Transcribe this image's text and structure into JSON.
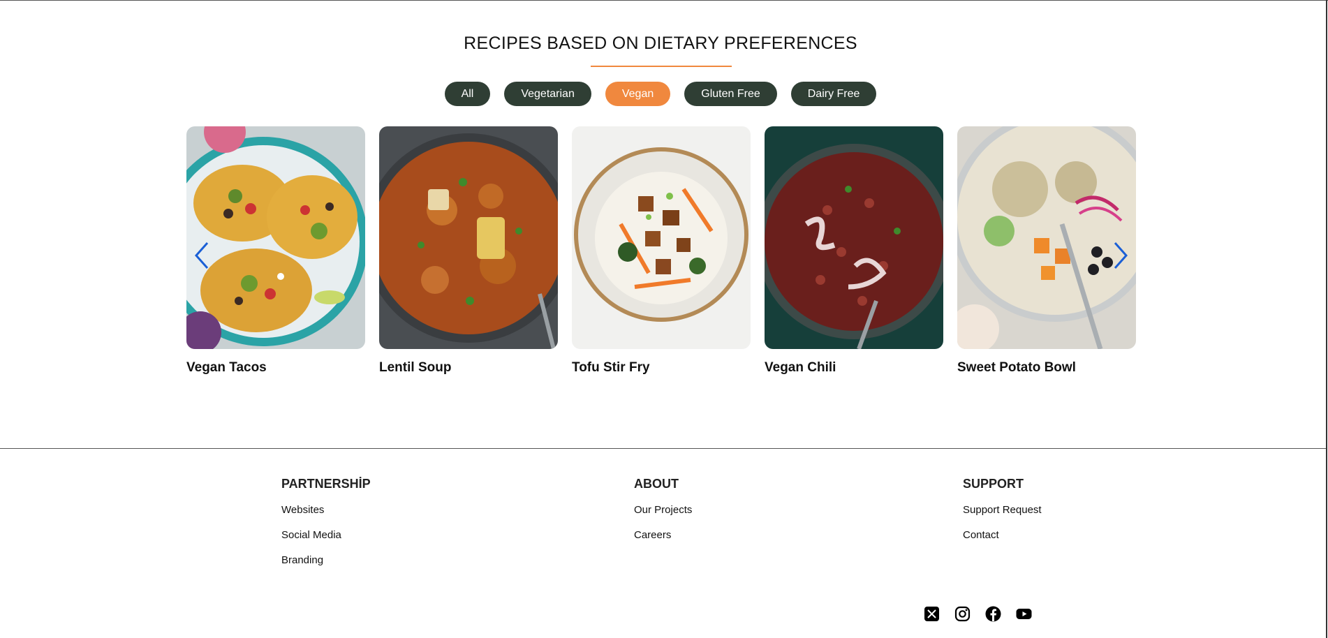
{
  "section": {
    "title": "RECIPES BASED ON DIETARY PREFERENCES"
  },
  "filters": [
    {
      "label": "All",
      "active": false
    },
    {
      "label": "Vegetarian",
      "active": false
    },
    {
      "label": "Vegan",
      "active": true
    },
    {
      "label": "Gluten Free",
      "active": false
    },
    {
      "label": "Dairy Free",
      "active": false
    }
  ],
  "recipes": [
    {
      "name": "Vegan Tacos"
    },
    {
      "name": "Lentil Soup"
    },
    {
      "name": "Tofu Stir Fry"
    },
    {
      "name": "Vegan Chili"
    },
    {
      "name": "Sweet Potato Bowl"
    }
  ],
  "footer": {
    "partnership": {
      "heading": "PARTNERSHİP",
      "links": [
        "Websites",
        "Social Media",
        "Branding"
      ]
    },
    "about": {
      "heading": "ABOUT",
      "links": [
        "Our Projects",
        "Careers"
      ]
    },
    "support": {
      "heading": "SUPPORT",
      "links": [
        "Support Request",
        "Contact"
      ]
    }
  },
  "socials": [
    {
      "icon": "x-twitter-icon"
    },
    {
      "icon": "instagram-icon"
    },
    {
      "icon": "facebook-icon"
    },
    {
      "icon": "youtube-icon"
    }
  ],
  "colors": {
    "accent": "#f0883e",
    "chip": "#2f3e34"
  }
}
